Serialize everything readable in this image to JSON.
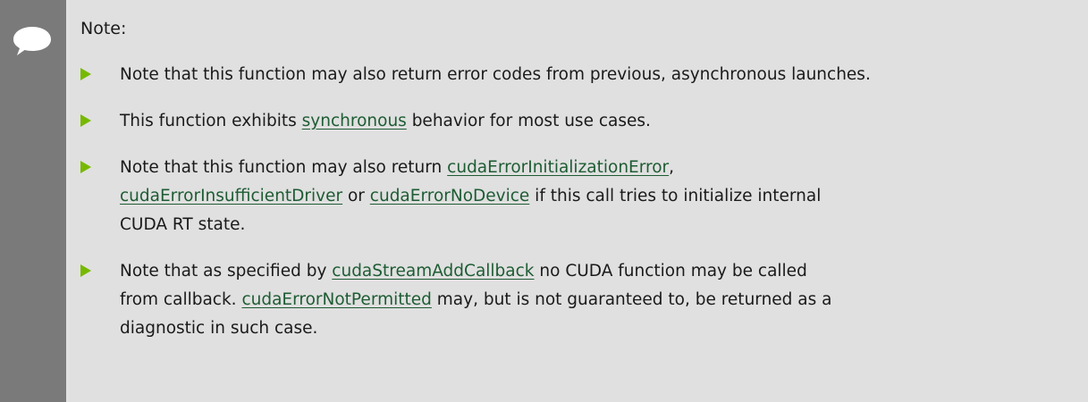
{
  "note": {
    "title": "Note:",
    "items": [
      {
        "t1": "Note that this function may also return error codes from previous, asynchronous launches."
      },
      {
        "t1": "This function exhibits ",
        "link1": "synchronous",
        "t2": " behavior for most use cases."
      },
      {
        "t1": "Note that this function may also return ",
        "link1": "cudaErrorInitializationError",
        "t2": ",",
        "link2": "cudaErrorInsufficientDriver",
        "t3": " or ",
        "link3": "cudaErrorNoDevice",
        "t4": " if this call tries to initialize internal",
        "t5": "CUDA RT state."
      },
      {
        "t1": "Note that as specified by ",
        "link1": "cudaStreamAddCallback",
        "t2": " no CUDA function may be called",
        "t3": "from callback. ",
        "link2": "cudaErrorNotPermitted",
        "t4": " may, but is not guaranteed to, be returned as a",
        "t5": "diagnostic in such case."
      }
    ]
  },
  "colors": {
    "bullet": "#76b900",
    "link": "#1d5c33",
    "sidebar": "#7a7a7a",
    "background": "#e0e0e0"
  },
  "icons": {
    "note": "speech-bubble-icon",
    "bullet": "triangle-bullet-icon"
  }
}
